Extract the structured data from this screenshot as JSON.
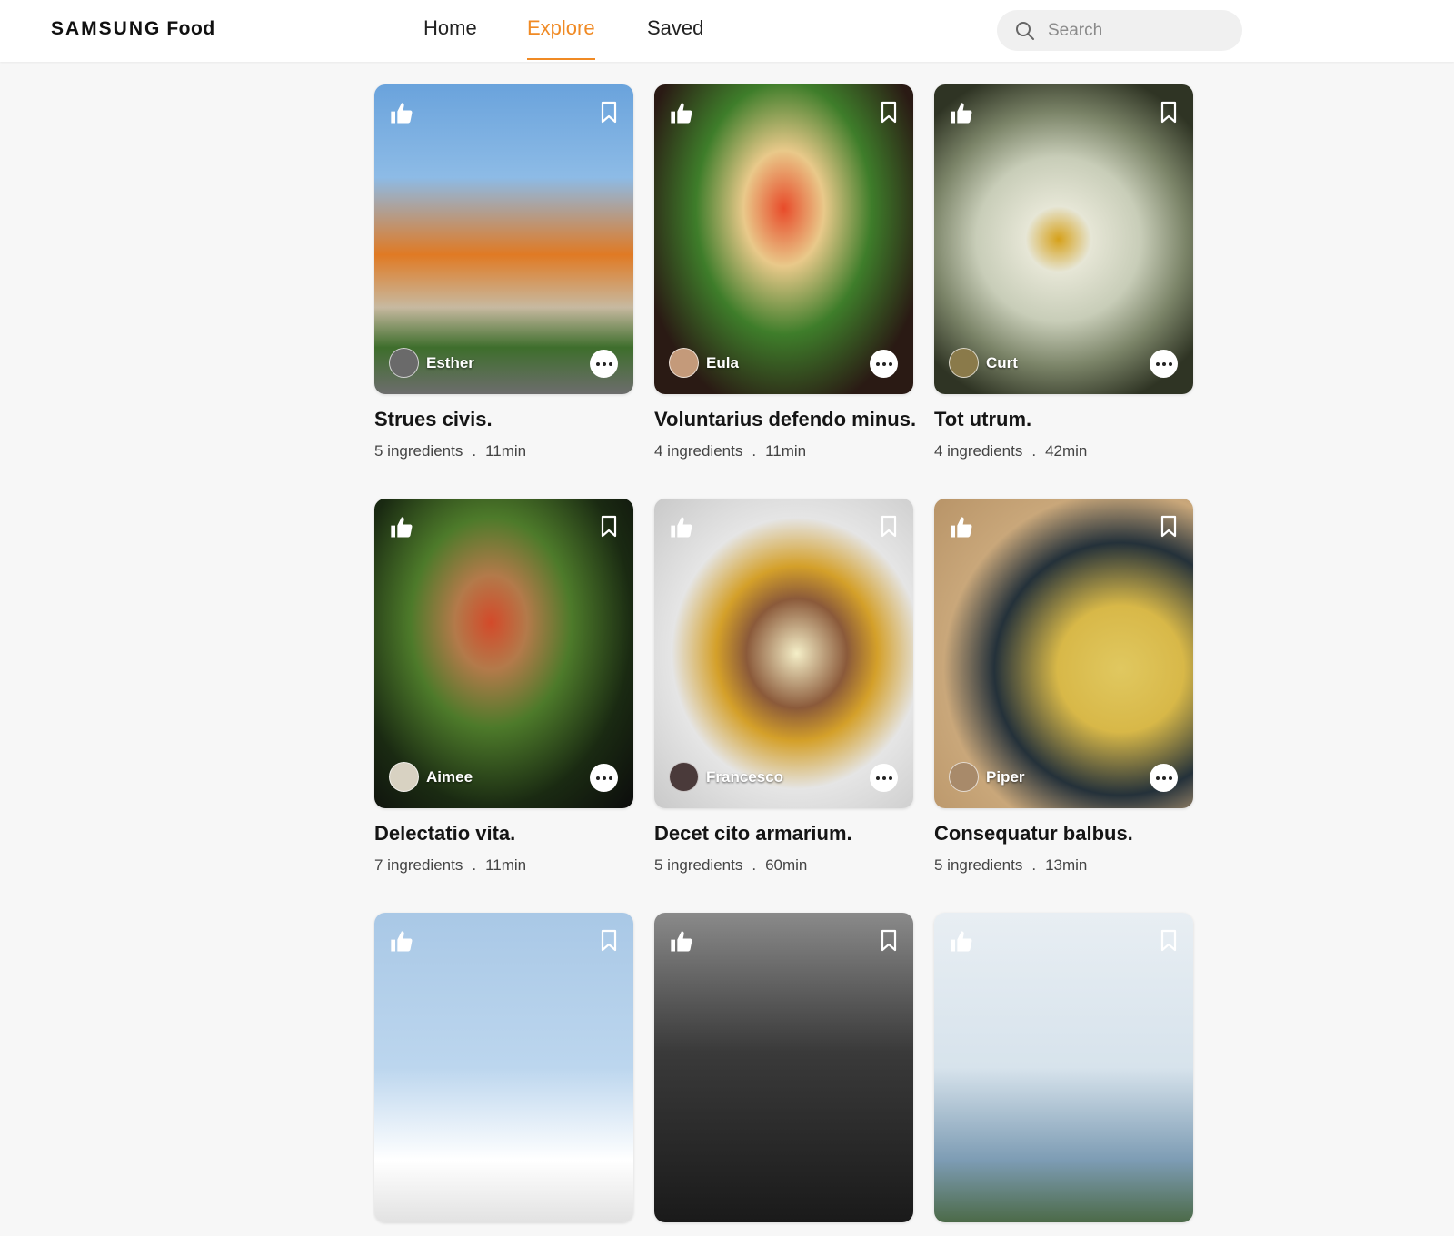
{
  "header": {
    "logo_brand": "SAMSUNG",
    "logo_product": "Food",
    "nav": [
      {
        "label": "Home",
        "active": false
      },
      {
        "label": "Explore",
        "active": true
      },
      {
        "label": "Saved",
        "active": false
      }
    ],
    "search": {
      "placeholder": "Search"
    },
    "accent_color": "#f08a24"
  },
  "cards": [
    {
      "author": "Esther",
      "title": "Strues civis.",
      "ingredients": "5 ingredients",
      "time": "11min",
      "image": "orange-roof-building-with-spire"
    },
    {
      "author": "Eula",
      "title": "Voluntarius defendo minus.",
      "ingredients": "4 ingredients",
      "time": "11min",
      "image": "salad-with-shredded-vegetables"
    },
    {
      "author": "Curt",
      "title": "Tot utrum.",
      "ingredients": "4 ingredients",
      "time": "42min",
      "image": "white-rose-with-bee"
    },
    {
      "author": "Aimee",
      "title": "Delectatio vita.",
      "ingredients": "7 ingredients",
      "time": "11min",
      "image": "vegetable-portrait-art"
    },
    {
      "author": "Francesco",
      "title": "Decet cito armarium.",
      "ingredients": "5 ingredients",
      "time": "60min",
      "image": "cheesecake-slice-with-fruit"
    },
    {
      "author": "Piper",
      "title": "Consequatur balbus.",
      "ingredients": "5 ingredients",
      "time": "13min",
      "image": "bowl-of-french-fries"
    },
    {
      "author": "",
      "title": "",
      "ingredients": "",
      "time": "",
      "image": "protest-sign-scene"
    },
    {
      "author": "",
      "title": "",
      "ingredients": "",
      "time": "",
      "image": "black-and-white-street-scene"
    },
    {
      "author": "",
      "title": "",
      "ingredients": "",
      "time": "",
      "image": "lake-landscape"
    }
  ],
  "icons": {
    "like": "thumbs-up-icon",
    "save": "bookmark-icon",
    "more": "more-options-icon",
    "search": "search-icon"
  }
}
